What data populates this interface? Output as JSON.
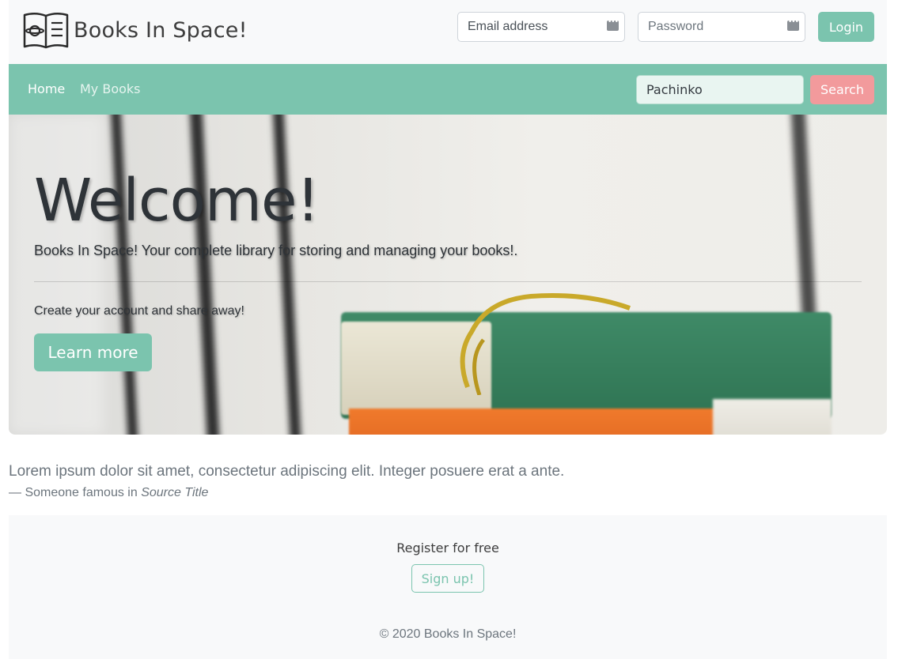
{
  "header": {
    "brand_name": "Books In Space!",
    "logo_icon": "open-book-planet-icon",
    "email_placeholder": "Email address",
    "password_placeholder": "Password",
    "login_label": "Login"
  },
  "nav": {
    "items": [
      {
        "label": "Home"
      },
      {
        "label": "My Books"
      }
    ],
    "search_value": "Pachinko",
    "search_label": "Search"
  },
  "hero": {
    "title": "Welcome!",
    "lead": "Books In Space! Your complete library for storing and managing your books!.",
    "sub": "Create your account and share away!",
    "cta_label": "Learn more"
  },
  "quote": {
    "text": "Lorem ipsum dolor sit amet, consectetur adipiscing elit. Integer posuere erat a ante.",
    "attribution": "— Someone famous in ",
    "source": "Source Title"
  },
  "footer": {
    "heading": "Register for free",
    "signup_label": "Sign up!",
    "copyright": "© 2020 Books In Space!"
  },
  "colors": {
    "accent": "#7bc4ae",
    "search_button": "#f29a9c"
  }
}
